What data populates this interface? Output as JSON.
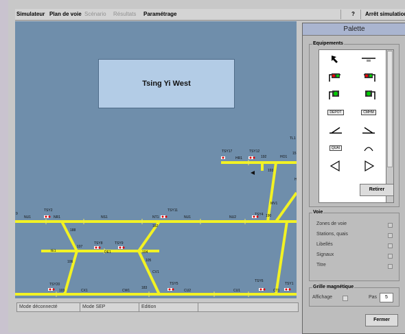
{
  "menu": {
    "simulateur": "Simulateur",
    "plan_de_voie": "Plan de voie",
    "scenario": "Scénario",
    "resultats": "Résultats",
    "parametrage": "Paramétrage",
    "help": "?",
    "arret": "Arrêt simulation"
  },
  "canvas": {
    "station_title": "Tsing Yi West",
    "labels": [
      "9",
      "NU1",
      "TSY2",
      "NR1",
      "NS1",
      "NT1",
      "TSY11",
      "NU1",
      "NU2",
      "TSY4",
      "190",
      "TSY17",
      "HR1",
      "TSY12",
      "192",
      "HO1",
      "193",
      "TL1",
      "HP",
      "MV1",
      "182",
      "188",
      "107",
      "TSY8",
      "TSY9",
      "DE1",
      "IE1",
      "104",
      "105",
      "106",
      "CV1",
      "TSY20",
      "103",
      "CX1",
      "CW1",
      "183",
      "TSY5",
      "CU2",
      "CU1",
      "TSY6",
      "CT1",
      "TSY1",
      "181",
      "15"
    ]
  },
  "palette": {
    "title": "Palette",
    "equipements_title": "Equipements",
    "equipment_icons": [
      "arrow-select-icon",
      "track-label-icon",
      "signal-green-left-icon",
      "signal-red-right-icon",
      "signal-green-left-large-icon",
      "signal-green-right-large-icon",
      "depot-icon",
      "cmhm-icon",
      "switch-left-icon",
      "switch-right-icon",
      "quai-icon",
      "arc-icon",
      "triangle-left-icon",
      "triangle-right-icon"
    ],
    "depot_label": "DEPOT",
    "cmhm_label": "CMHM",
    "quai_label": "QUAI",
    "retirer": "Retirer",
    "voie_title": "Voie",
    "voie_items": [
      "Zones de voie",
      "Stations, quais",
      "Libellés",
      "Signaux",
      "Titre"
    ],
    "grille_title": "Grille magnétique",
    "affichage": "Affichage",
    "pas": "Pas",
    "pas_value": "5",
    "fermer": "Fermer"
  },
  "status": {
    "mode1": "Mode déconnecté",
    "mode2": "Mode SEP",
    "mode3": "Edition"
  },
  "colors": {
    "track": "#f2f224",
    "canvas_bg": "#6f8eab"
  }
}
